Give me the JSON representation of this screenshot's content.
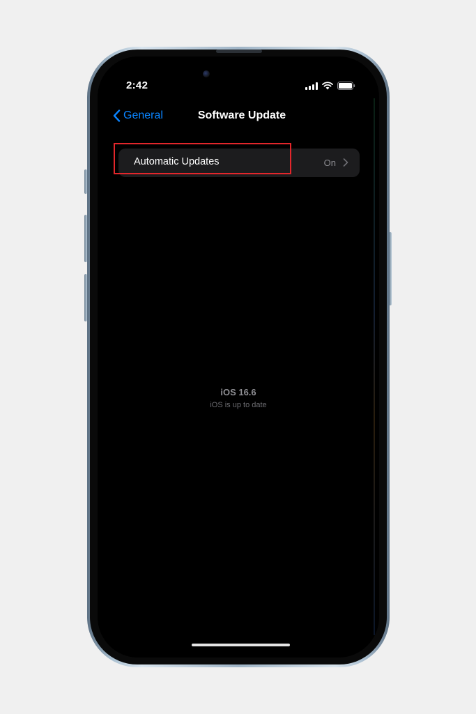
{
  "status_bar": {
    "time": "2:42",
    "icons": [
      "cellular-signal-icon",
      "wifi-icon",
      "battery-icon"
    ]
  },
  "nav": {
    "back_label": "General",
    "title": "Software Update"
  },
  "settings": {
    "automatic_updates": {
      "label": "Automatic Updates",
      "value": "On"
    }
  },
  "update_status": {
    "version": "iOS 16.6",
    "message": "iOS is up to date"
  },
  "colors": {
    "accent": "#0a84ff",
    "highlight": "#e3262b",
    "row_background": "#1c1c1e"
  }
}
